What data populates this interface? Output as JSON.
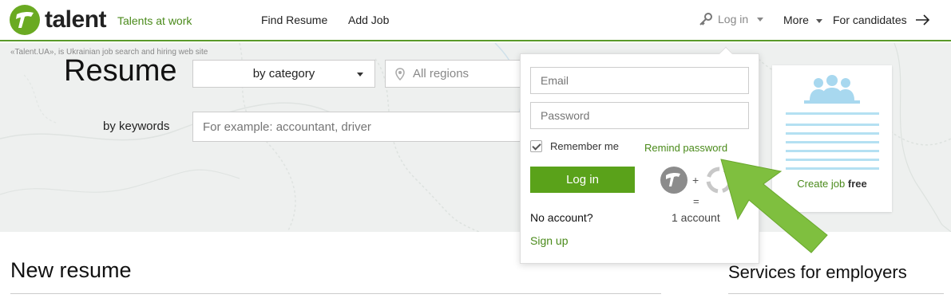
{
  "header": {
    "logo_text": "talent",
    "tagline": "Talents at work",
    "nav": [
      {
        "label": "Find Resume"
      },
      {
        "label": "Add Job"
      }
    ],
    "login_label": "Log in",
    "more_label": "More",
    "candidates_label": "For candidates"
  },
  "hero": {
    "note": "«Talent.UA», is Ukrainian job search and hiring web site",
    "title": "Resume",
    "category_select": "by category",
    "region_placeholder": "All regions",
    "keywords_label": "by keywords",
    "keywords_placeholder": "For example: accountant, driver"
  },
  "login_dropdown": {
    "email_placeholder": "Email",
    "password_placeholder": "Password",
    "remember_label": "Remember me",
    "remember_checked": true,
    "remind_label": "Remind password",
    "login_button": "Log in",
    "no_account": "No account?",
    "sign_up": "Sign up",
    "plus": "+",
    "equals": "=",
    "one_account": "1 account"
  },
  "job_card": {
    "create_label": "Create job",
    "free_label": "free"
  },
  "sections": {
    "new_resume": "New resume",
    "services": "Services for employers"
  },
  "colors": {
    "brand_green": "#5aa21a",
    "link_green": "#4a8a1a",
    "arrow_green": "#7fbf3f"
  }
}
